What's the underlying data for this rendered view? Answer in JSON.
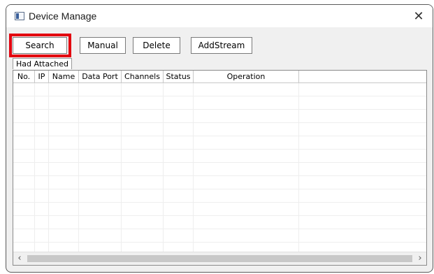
{
  "window": {
    "title": "Device Manage"
  },
  "toolbar": {
    "search_label": "Search",
    "manual_label": "Manual",
    "delete_label": "Delete",
    "addstream_label": "AddStream"
  },
  "tab": {
    "label": "Had Attached"
  },
  "table": {
    "columns": [
      "No.",
      "IP",
      "Name",
      "Data Port",
      "Channels",
      "Status",
      "Operation"
    ],
    "rows": []
  },
  "colors": {
    "highlight": "#e3000f"
  },
  "icons": {
    "close": "close-icon",
    "app": "app-window-icon"
  }
}
